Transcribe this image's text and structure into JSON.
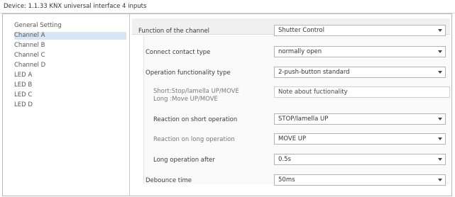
{
  "window": {
    "title": "Device: 1.1.33  KNX universal interface  4 inputs"
  },
  "sidebar": {
    "items": [
      {
        "label": "General Setting"
      },
      {
        "label": "Channel A",
        "selected": true
      },
      {
        "label": "Channel B"
      },
      {
        "label": "Channel C"
      },
      {
        "label": "Channel D"
      },
      {
        "label": "LED A"
      },
      {
        "label": "LED B"
      },
      {
        "label": "LED C"
      },
      {
        "label": "LED D"
      }
    ]
  },
  "params": {
    "function": {
      "label": "Function of the channel",
      "value": "Shutter Control"
    },
    "contact_type": {
      "label": "Connect contact type",
      "value": "normally open"
    },
    "operation_type": {
      "label": "Operation functionality type",
      "value": "2-push-button standard"
    },
    "note": {
      "label_line1": "Short:Stop/lamella UP/MOVE",
      "label_line2": "Long :Move UP/MOVE",
      "value": "Note about fuctionality"
    },
    "short_reaction": {
      "label": "Reaction on short operation",
      "value": "STOP/lamella UP"
    },
    "long_reaction": {
      "label": "Reaction on long operation",
      "value": "MOVE UP"
    },
    "long_after": {
      "label": "Long operation after",
      "value": "0.5s"
    },
    "debounce": {
      "label": "Debounce time",
      "value": "50ms"
    }
  }
}
